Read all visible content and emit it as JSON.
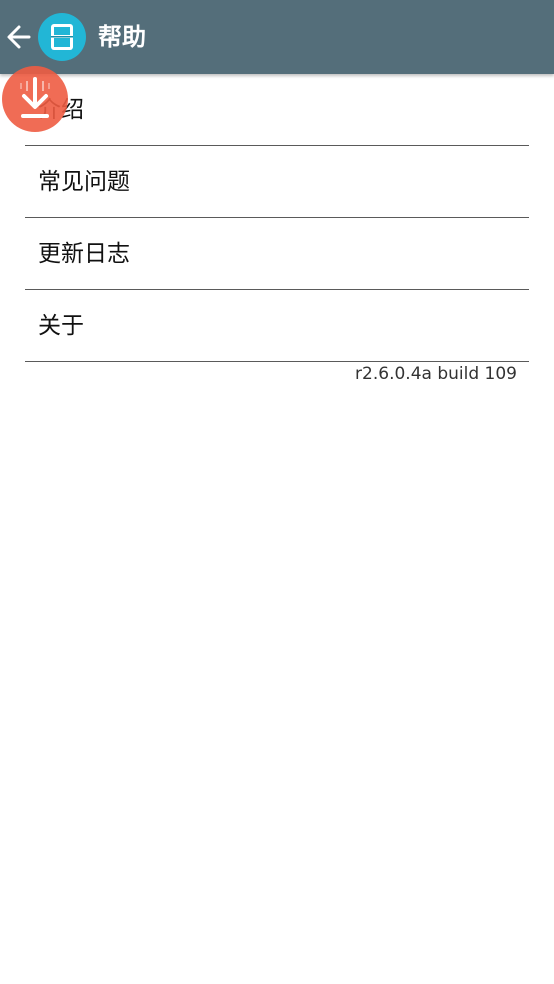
{
  "appbar": {
    "title": "帮助",
    "back_icon": "arrow-back-icon",
    "app_icon": "handheld-console-icon",
    "color": "#546e7a",
    "app_icon_color": "#22b6d6"
  },
  "menu": {
    "items": [
      {
        "label": "介绍"
      },
      {
        "label": "常见问题"
      },
      {
        "label": "更新日志"
      },
      {
        "label": "关于"
      }
    ]
  },
  "version": "r2.6.0.4a build 109",
  "overlay": {
    "icon": "download-icon",
    "color": "#ee5c42"
  }
}
